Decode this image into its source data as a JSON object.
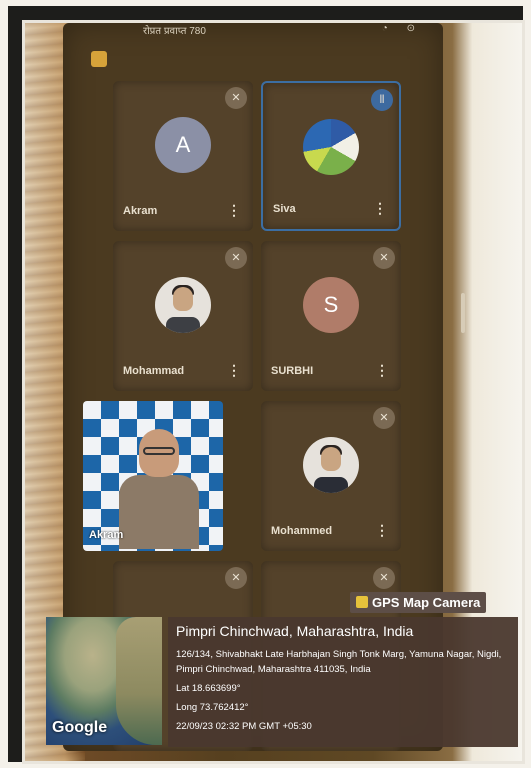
{
  "status": {
    "time": "रोप्रत प्रवाप्त 780",
    "icons": "◔ ⊙"
  },
  "participants": [
    {
      "name": "Akram",
      "initial": "A",
      "type": "letter"
    },
    {
      "name": "Siva",
      "type": "globe"
    },
    {
      "name": "Mohammad",
      "type": "photo"
    },
    {
      "name": "SURBHI",
      "initial": "S",
      "type": "letter"
    },
    {
      "name": "Akram",
      "type": "video"
    },
    {
      "name": "Mohammed",
      "type": "photo"
    }
  ],
  "overlay": {
    "app_label": "GPS Map Camera",
    "location_title": "Pimpri Chinchwad, Maharashtra, India",
    "address": "126/134, Shivabhakt Late Harbhajan Singh Tonk Marg, Yamuna Nagar, Nigdi, Pimpri Chinchwad, Maharashtra 411035, India",
    "lat": "Lat 18.663699°",
    "long": "Long 73.762412°",
    "datetime": "22/09/23 02:32 PM GMT +05:30",
    "map_brand": "Google"
  },
  "icons": {
    "mic_off": "mic-off-icon",
    "menu": "more-vert-icon",
    "audio": "audio-wave-icon"
  },
  "colors": {
    "active_border": "#3c6ea2",
    "overlay_bg": "#4a382e"
  }
}
